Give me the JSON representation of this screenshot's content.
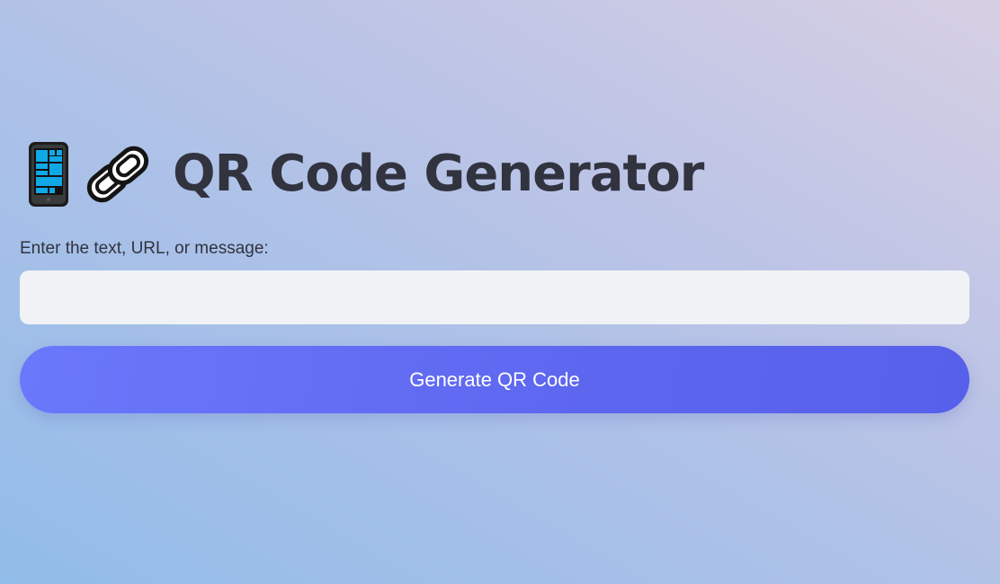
{
  "header": {
    "title": "QR Code Generator",
    "icons": [
      "mobile-phone-icon",
      "link-icon"
    ]
  },
  "form": {
    "input_label": "Enter the text, URL, or message:",
    "input_value": "",
    "input_placeholder": "",
    "button_label": "Generate QR Code"
  },
  "colors": {
    "accent": "#5f6cf3",
    "input_background": "#f0f2f6",
    "text": "#31333f"
  }
}
